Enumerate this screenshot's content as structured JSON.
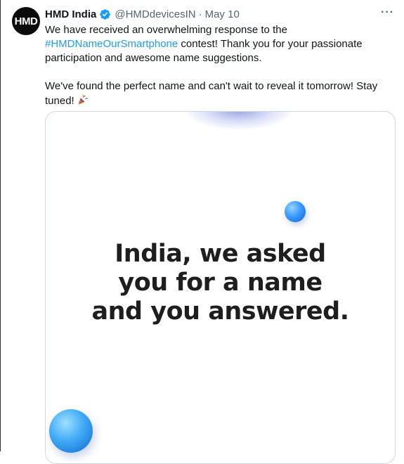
{
  "tweet": {
    "author_name": "HMD India",
    "avatar_text": "HMD",
    "handle": "@HMDdevicesIN",
    "separator": "·",
    "date": "May 10",
    "more_icon": "···",
    "text_part1": "We have received an overwhelming response to the ",
    "hashtag": "#HMDNameOurSmartphone",
    "text_part2": " contest! Thank you for your passionate participation and awesome name suggestions.",
    "text_para2": "We've found the perfect name and can't wait to reveal it tomorrow! Stay tuned!",
    "emoji": "party-popper-icon"
  },
  "media": {
    "headline_line1": "India, we asked",
    "headline_line2": "you for a name",
    "headline_line3": "and you answered."
  },
  "colors": {
    "link": "#1d9bf0",
    "secondary_text": "#536471",
    "verified_badge": "#1d9bf0"
  }
}
